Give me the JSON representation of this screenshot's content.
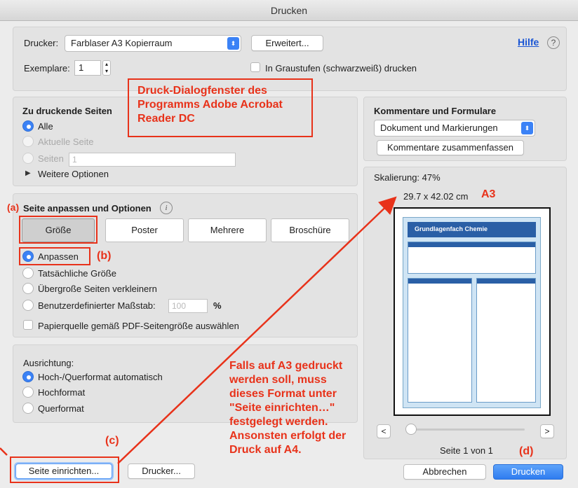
{
  "window": {
    "title": "Drucken"
  },
  "printer": {
    "label": "Drucker:",
    "value": "Farblaser A3 Kopierraum",
    "advanced_button": "Erweitert...",
    "help_link": "Hilfe",
    "help_icon": "?"
  },
  "copies": {
    "label": "Exemplare:",
    "value": "1",
    "grayscale_label": "In Graustufen (schwarzweiß) drucken"
  },
  "pages": {
    "heading": "Zu druckende Seiten",
    "options": [
      "Alle",
      "Aktuelle Seite",
      "Seiten"
    ],
    "pages_field_value": "1",
    "more_options": "Weitere Optionen"
  },
  "fit": {
    "heading": "Seite anpassen und Optionen",
    "info_icon": "i",
    "tabs": [
      "Größe",
      "Poster",
      "Mehrere",
      "Broschüre"
    ],
    "options": [
      "Anpassen",
      "Tatsächliche Größe",
      "Übergroße Seiten verkleinern",
      "Benutzerdefinierter Maßstab:"
    ],
    "scale_value": "100",
    "scale_unit": "%",
    "paper_source_label": "Papierquelle gemäß PDF-Seitengröße auswählen"
  },
  "orientation": {
    "heading": "Ausrichtung:",
    "options": [
      "Hoch-/Querformat automatisch",
      "Hochformat",
      "Querformat"
    ]
  },
  "comments": {
    "heading": "Kommentare und Formulare",
    "select_value": "Dokument und Markierungen",
    "summarize_button": "Kommentare zusammenfassen"
  },
  "preview": {
    "scaling": "Skalierung: 47%",
    "size": "29.7 x 42.02 cm",
    "page_indicator": "Seite 1 von 1",
    "prev_button": "<",
    "next_button": ">",
    "doc_title": "Grundlagenfach Chemie"
  },
  "footer": {
    "page_setup_button": "Seite einrichten...",
    "printer_button": "Drucker...",
    "cancel_button": "Abbrechen",
    "print_button": "Drucken"
  },
  "annotations": {
    "dialog_note": [
      "Druck-Dialogfenster des",
      "Programms Adobe Acrobat",
      "Reader DC"
    ],
    "a3_label": "A3",
    "marker_a": "(a)",
    "marker_b": "(b)",
    "marker_c": "(c)",
    "marker_d": "(d)",
    "a3_note": [
      "Falls auf A3 gedruckt",
      "werden soll, muss",
      "dieses Format unter",
      "\"Seite einrichten…\"",
      "festgelegt werden.",
      "Ansonsten erfolgt der",
      "Druck auf A4."
    ]
  },
  "colors": {
    "accent": "#3b82f6",
    "annotation": "#e8321a"
  }
}
